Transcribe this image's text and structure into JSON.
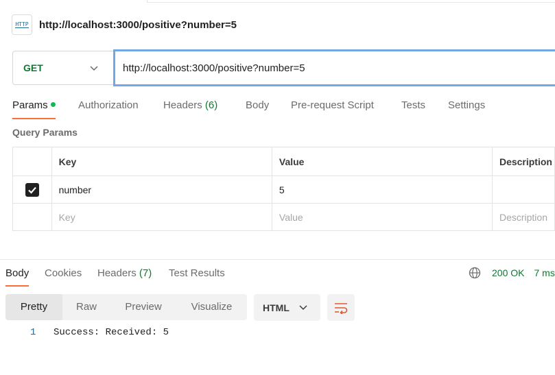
{
  "request": {
    "icon_label": "HTTP",
    "title": "http://localhost:3000/positive?number=5",
    "method": "GET",
    "url": "http://localhost:3000/positive?number=5"
  },
  "request_tabs": {
    "params": "Params",
    "authorization": "Authorization",
    "headers": "Headers",
    "headers_count": "(6)",
    "body": "Body",
    "prerequest": "Pre-request Script",
    "tests": "Tests",
    "settings": "Settings"
  },
  "query_params": {
    "label": "Query Params",
    "columns": [
      "Key",
      "Value",
      "Description"
    ],
    "rows": [
      {
        "checked": true,
        "key": "number",
        "value": "5",
        "description": ""
      }
    ],
    "placeholder": {
      "key": "Key",
      "value": "Value",
      "description": "Description"
    }
  },
  "response_tabs": {
    "body": "Body",
    "cookies": "Cookies",
    "headers": "Headers",
    "headers_count": "(7)",
    "test_results": "Test Results"
  },
  "status": {
    "code": "200 OK",
    "time": "7 ms"
  },
  "view": {
    "options": [
      "Pretty",
      "Raw",
      "Preview",
      "Visualize"
    ],
    "selected": "Pretty",
    "language": "HTML"
  },
  "response_body": [
    {
      "line": "1",
      "text": "Success: Received: 5"
    }
  ],
  "colors": {
    "accent": "#ff6c37",
    "success": "#0b7a2f",
    "focus": "#6fa8e4"
  },
  "icons": [
    "http-icon",
    "chevron-down-icon",
    "check-icon",
    "globe-icon",
    "wrap-lines-icon"
  ]
}
